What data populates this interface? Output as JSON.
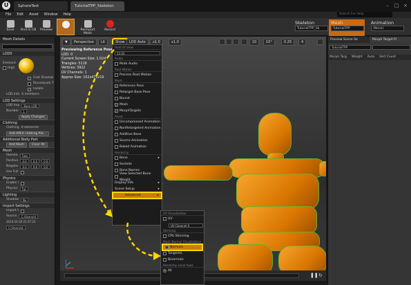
{
  "titlebar": {
    "tabs": [
      "SphereTest",
      "TutorialTPP_Skeleton"
    ],
    "help_placeholder": "Search For Help",
    "window_buttons": [
      "minimize",
      "maximize",
      "close"
    ]
  },
  "menu": [
    "File",
    "Edit",
    "Asset",
    "Window",
    "Help"
  ],
  "toolbar": [
    {
      "label": "Save",
      "icon": "save-icon"
    },
    {
      "label": "Find in CB",
      "icon": "find-icon"
    },
    {
      "label": "Preview",
      "icon": "preview-icon"
    },
    {
      "label": "Reimport Mesh",
      "icon": "reimport-icon"
    },
    {
      "label": "Record",
      "icon": "record-icon"
    }
  ],
  "modes": {
    "skeleton": {
      "label": "Skeleton",
      "value": "TutorialTPP_Sk"
    },
    "mesh": {
      "label": "Mesh",
      "value": "TutorialTPP"
    },
    "animation": {
      "label": "Animation",
      "value": "(None)"
    }
  },
  "left_panel": {
    "tab": "Mesh Details",
    "sections": [
      "LOD0",
      "LOD Settings",
      "Clothing",
      "Additional Body Part",
      "Mesh",
      "Physics",
      "Lighting",
      "Import Settings"
    ],
    "lod0": {
      "element": "Element",
      "high": "High",
      "cast_shadow": "Cast Shadow",
      "recompute": "Recompute T",
      "isolate": "Isolate"
    },
    "lod_info": "LOD Info",
    "lod_info_value": "6 members",
    "lod_settings": {
      "lod_import_label": "LOD Imp",
      "lod_import_value": "Base LOD",
      "number_label": "Number",
      "number_value": "1",
      "apply": "Apply Changes"
    },
    "clothing": {
      "label": "Clothing",
      "value": "0 elements",
      "add": "Add APEX clothing file..."
    },
    "body": {
      "add": "Add Mesh",
      "clear": "Clear All"
    },
    "mesh": {
      "skeleton_label": "Skelete",
      "skeleton_value": "Tuto",
      "positive_label": "Positive",
      "negative_label": "Negativ",
      "use_full_label": "Use Full",
      "values": [
        "0.0",
        "0.0",
        "0.0"
      ]
    },
    "physics": {
      "enable_label": "Enable I",
      "physics_label": "Physics",
      "physics_value": "Tut"
    },
    "lighting": {
      "shadow_label": "Shadow",
      "shadow_value": "No"
    },
    "import": {
      "import_label": "Import t",
      "source_label": "Source",
      "source_value": "C:/Users/st",
      "date": "2014-10-30 21:37:22",
      "source_value2": "C:/Users/st"
    }
  },
  "viewport": {
    "buttons": [
      "Perspective",
      "Lit",
      "Show",
      "LOD Auto",
      "x1.0",
      "x1.0"
    ],
    "snap_values": [
      "10",
      "10°",
      "0.25",
      "4"
    ],
    "info": {
      "header": "Previewing Reference Pose",
      "lod": "LOD: 0",
      "screen_size": "Current Screen Size: 1.024",
      "triangles": "Triangles: 5118",
      "vertices": "Vertices: 3922",
      "uv_channels": "UV Channels: 1",
      "approx_size": "Approx Size: 102x47x219"
    }
  },
  "show_menu": {
    "fov_label": "Field Of View",
    "fov_value": "53.43",
    "sections": [
      {
        "title": "Audio",
        "items": [
          {
            "label": "Mute Audio",
            "checked": false
          }
        ]
      },
      {
        "title": "Root Motion",
        "items": [
          {
            "label": "Process Root Motion",
            "checked": false
          }
        ]
      },
      {
        "title": "Mesh",
        "items": [
          {
            "label": "Reference Pose",
            "checked": true
          },
          {
            "label": "Retarget Base Pose",
            "checked": false
          },
          {
            "label": "Bound",
            "checked": false
          },
          {
            "label": "Mesh",
            "checked": true
          },
          {
            "label": "MorphTargets",
            "checked": true
          }
        ]
      },
      {
        "title": "Asset",
        "items": [
          {
            "label": "Uncompressed Animation",
            "checked": false
          },
          {
            "label": "NonRetargeted Animation",
            "checked": false
          },
          {
            "label": "Additive Base",
            "checked": false
          },
          {
            "label": "Source Animation",
            "checked": false
          },
          {
            "label": "Baked Animation",
            "checked": false
          }
        ]
      },
      {
        "title": "Hierarchy",
        "items": [
          {
            "label": "Bone",
            "checked": false,
            "arrow": true
          },
          {
            "label": "Sockets",
            "checked": false
          },
          {
            "label": "Bone Names",
            "checked": false
          },
          {
            "label": "View Selected Bone Weight",
            "checked": false
          }
        ]
      }
    ],
    "display_info": "Display Info",
    "scene_setup": "Scene Setup",
    "advanced": "Advanced"
  },
  "advanced_menu": {
    "uv_title": "UV Visualization",
    "uv": "UV",
    "uv_channel": "UV Channel 0",
    "skinning_title": "Skinning",
    "cpu_skinning": "CPU Skinning",
    "normals_title": "Mesh Normal Visualization",
    "normals": "Normals",
    "tangents": "Tangents",
    "binormals": "Binormals",
    "hierarchy_title": "Hierarchy Local Axes",
    "all": "All"
  },
  "right_panel": {
    "tabs": [
      "Preview Scene Se",
      "Morph Target Pr"
    ],
    "morph_name": "TutorialTPP",
    "columns": [
      "Morph Targ",
      "Weight",
      "Auto",
      "Vert Count"
    ]
  },
  "colors": {
    "accent": "#c96a14",
    "highlight": "#ffd700",
    "mesh": "#e58a10",
    "normals": "#6ab031"
  }
}
